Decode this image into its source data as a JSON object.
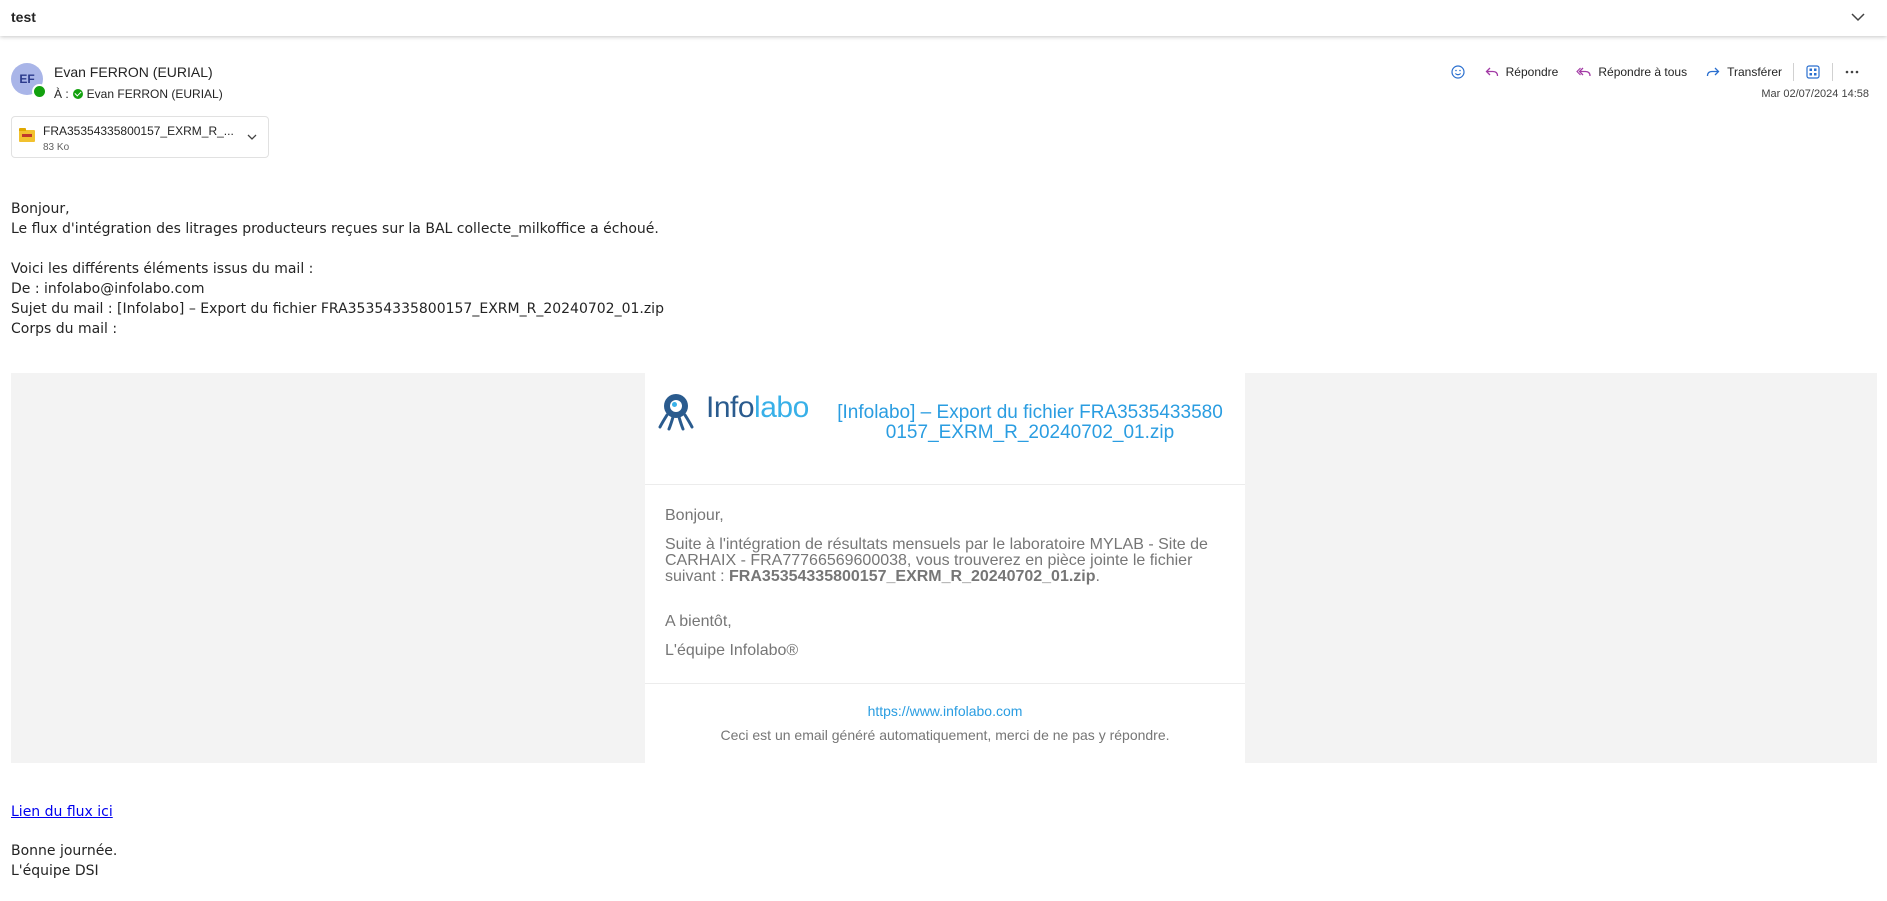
{
  "subject": "test",
  "sender": {
    "initials": "EF",
    "name": "Evan FERRON (EURIAL)",
    "to_label": "À :",
    "to_name": "Evan FERRON (EURIAL)"
  },
  "toolbar": {
    "reply": "Répondre",
    "reply_all": "Répondre à tous",
    "forward": "Transférer"
  },
  "date": "Mar 02/07/2024 14:58",
  "attachment": {
    "name": "FRA35354335800157_EXRM_R_...",
    "size": "83 Ko"
  },
  "body": {
    "greeting": "Bonjour,",
    "line1": "Le flux d'intégration des litrages producteurs reçues sur la BAL collecte_milkoffice a échoué.",
    "line2": "Voici les différents éléments issus du mail :",
    "from": "De : infolabo@infolabo.com",
    "subject_line": "Sujet du mail : [Infolabo] – Export du fichier FRA35354335800157_EXRM_R_20240702_01.zip",
    "corps": "Corps du mail :",
    "link": "Lien du flux ici",
    "closing": "Bonne journée.",
    "signature": "L'équipe DSI"
  },
  "embedded": {
    "logo_part1": "Info",
    "logo_part2": "labo",
    "title": "[Infolabo] – Export du fichier FRA35354335800157_EXRM_R_20240702_01.zip",
    "greeting": "Bonjour,",
    "para_start": "Suite à l'intégration de résultats mensuels par le laboratoire MYLAB - Site de CARHAIX - FRA77766569600038, vous trouverez en pièce jointe le fichier suivant : ",
    "para_file": "FRA35354335800157_EXRM_R_20240702_01.zip",
    "para_end": ".",
    "bientot": "A bientôt,",
    "team": "L'équipe Infolabo®",
    "url": "https://www.infolabo.com",
    "footer": "Ceci est un email généré automatiquement, merci de ne pas y répondre."
  },
  "colors": {
    "accent_blue": "#2a9de1",
    "reply_purple": "#a23aa5",
    "presence_green": "#13a10e",
    "embed_background": "#f3f3f3"
  },
  "icons": [
    "chevron-down-icon",
    "emoji-icon",
    "reply-icon",
    "reply-all-icon",
    "forward-icon",
    "apps-icon",
    "more-icon",
    "zip-file-icon",
    "infolabo-octopus-logo"
  ]
}
